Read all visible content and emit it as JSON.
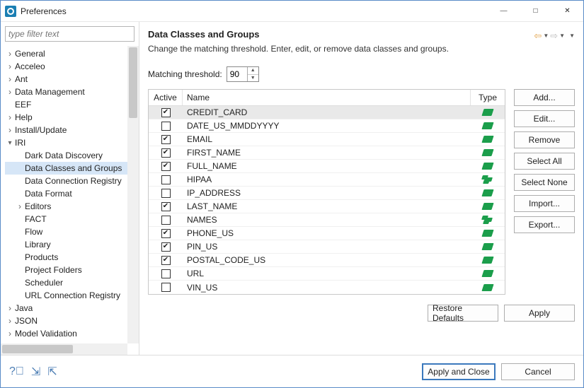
{
  "window": {
    "title": "Preferences"
  },
  "filter": {
    "placeholder": "type filter text"
  },
  "tree": [
    {
      "label": "General",
      "depth": 0,
      "twist": "col"
    },
    {
      "label": "Acceleo",
      "depth": 0,
      "twist": "col"
    },
    {
      "label": "Ant",
      "depth": 0,
      "twist": "col"
    },
    {
      "label": "Data Management",
      "depth": 0,
      "twist": "col"
    },
    {
      "label": "EEF",
      "depth": 0,
      "twist": "none"
    },
    {
      "label": "Help",
      "depth": 0,
      "twist": "col"
    },
    {
      "label": "Install/Update",
      "depth": 0,
      "twist": "col"
    },
    {
      "label": "IRI",
      "depth": 0,
      "twist": "exp"
    },
    {
      "label": "Dark Data Discovery",
      "depth": 1,
      "twist": "none"
    },
    {
      "label": "Data Classes and Groups",
      "depth": 1,
      "twist": "none",
      "selected": true
    },
    {
      "label": "Data Connection Registry",
      "depth": 1,
      "twist": "none"
    },
    {
      "label": "Data Format",
      "depth": 1,
      "twist": "none"
    },
    {
      "label": "Editors",
      "depth": 1,
      "twist": "col"
    },
    {
      "label": "FACT",
      "depth": 1,
      "twist": "none"
    },
    {
      "label": "Flow",
      "depth": 1,
      "twist": "none"
    },
    {
      "label": "Library",
      "depth": 1,
      "twist": "none"
    },
    {
      "label": "Products",
      "depth": 1,
      "twist": "none"
    },
    {
      "label": "Project Folders",
      "depth": 1,
      "twist": "none"
    },
    {
      "label": "Scheduler",
      "depth": 1,
      "twist": "none"
    },
    {
      "label": "URL Connection Registry",
      "depth": 1,
      "twist": "none"
    },
    {
      "label": "Java",
      "depth": 0,
      "twist": "col"
    },
    {
      "label": "JSON",
      "depth": 0,
      "twist": "col"
    },
    {
      "label": "Model Validation",
      "depth": 0,
      "twist": "col"
    }
  ],
  "page": {
    "title": "Data Classes and Groups",
    "description": "Change the matching threshold. Enter, edit, or remove data classes and groups.",
    "threshold_label": "Matching threshold:",
    "threshold_value": "90"
  },
  "columns": {
    "active": "Active",
    "name": "Name",
    "type": "Type"
  },
  "rows": [
    {
      "active": true,
      "name": "CREDIT_CARD",
      "type": "class",
      "selected": true
    },
    {
      "active": false,
      "name": "DATE_US_MMDDYYYY",
      "type": "class"
    },
    {
      "active": true,
      "name": "EMAIL",
      "type": "class"
    },
    {
      "active": true,
      "name": "FIRST_NAME",
      "type": "class"
    },
    {
      "active": true,
      "name": "FULL_NAME",
      "type": "class"
    },
    {
      "active": false,
      "name": "HIPAA",
      "type": "group"
    },
    {
      "active": false,
      "name": "IP_ADDRESS",
      "type": "class"
    },
    {
      "active": true,
      "name": "LAST_NAME",
      "type": "class"
    },
    {
      "active": false,
      "name": "NAMES",
      "type": "group"
    },
    {
      "active": true,
      "name": "PHONE_US",
      "type": "class"
    },
    {
      "active": true,
      "name": "PIN_US",
      "type": "class"
    },
    {
      "active": true,
      "name": "POSTAL_CODE_US",
      "type": "class"
    },
    {
      "active": false,
      "name": "URL",
      "type": "class"
    },
    {
      "active": false,
      "name": "VIN_US",
      "type": "class"
    }
  ],
  "side_buttons": {
    "add": "Add...",
    "edit": "Edit...",
    "remove": "Remove",
    "select_all": "Select All",
    "select_none": "Select None",
    "import": "Import...",
    "export": "Export..."
  },
  "lower_buttons": {
    "restore": "Restore Defaults",
    "apply": "Apply"
  },
  "footer_buttons": {
    "apply_close": "Apply and Close",
    "cancel": "Cancel"
  }
}
